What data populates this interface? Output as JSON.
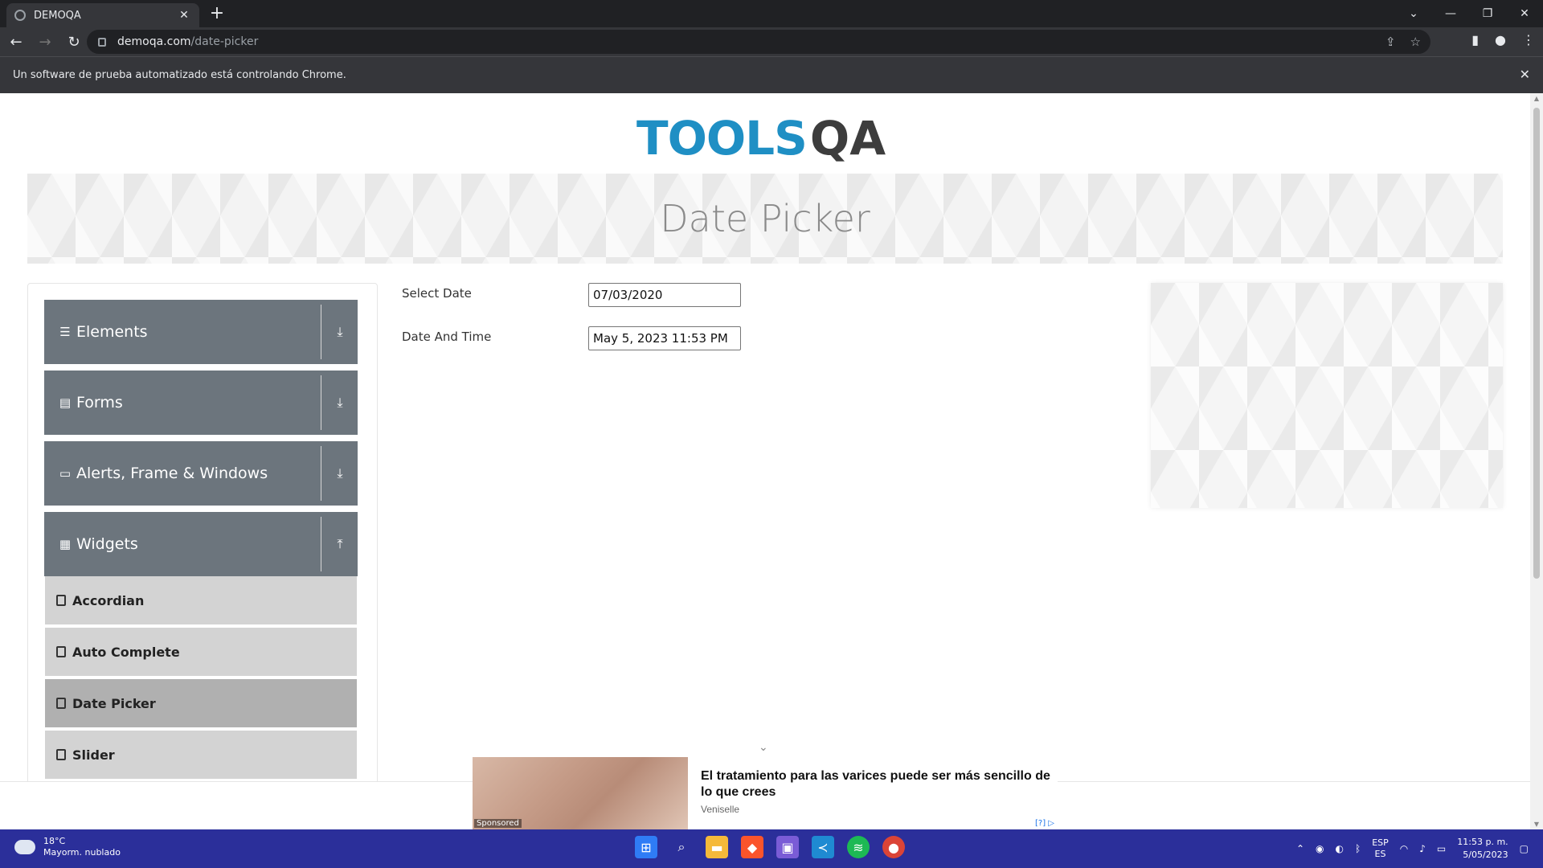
{
  "browser": {
    "tab_title": "DEMOQA",
    "url_host": "demoqa.com",
    "url_path": "/date-picker",
    "infobar_text": "Un software de prueba automatizado está controlando Chrome."
  },
  "page": {
    "logo_tools": "TOOLS",
    "logo_qa": "QA",
    "title": "Date Picker"
  },
  "sidebar": {
    "groups": [
      {
        "label": "Elements",
        "icon": "menu-icon"
      },
      {
        "label": "Forms",
        "icon": "document-icon"
      },
      {
        "label": "Alerts, Frame & Windows",
        "icon": "window-icon"
      },
      {
        "label": "Widgets",
        "icon": "widgets-icon"
      }
    ],
    "items": [
      {
        "label": "Accordian"
      },
      {
        "label": "Auto Complete"
      },
      {
        "label": "Date Picker",
        "active": true
      },
      {
        "label": "Slider"
      }
    ]
  },
  "form": {
    "select_date_label": "Select Date",
    "select_date_value": "07/03/2020",
    "date_time_label": "Date And Time",
    "date_time_value": "May 5, 2023 11:53 PM"
  },
  "ad": {
    "headline": "El tratamiento para las varices puede ser más sencillo de lo que crees",
    "brand": "Veniselle",
    "sponsored": "Sponsored",
    "choices": "[?]"
  },
  "taskbar": {
    "temperature": "18°C",
    "weather": "Mayorm. nublado",
    "lang_top": "ESP",
    "lang_bottom": "ES",
    "time": "11:53 p. m.",
    "date": "5/05/2023"
  },
  "colors": {
    "group_bg": "#6c757d",
    "item_bg": "#d3d3d3",
    "item_active_bg": "#b0b0b0",
    "logo_blue": "#1f8fc4",
    "taskbar_bg": "#2b2f9a"
  }
}
